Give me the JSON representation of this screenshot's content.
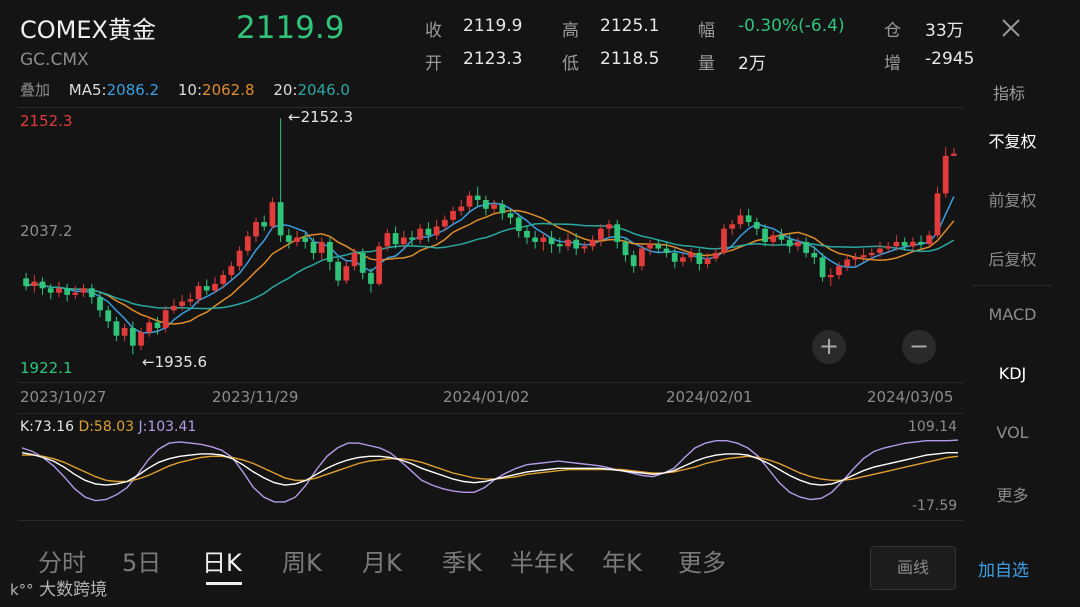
{
  "header": {
    "title": "COMEX黄金",
    "symbol": "GC.CMX",
    "price": "2119.9",
    "quote": {
      "close_label": "收",
      "close": "2119.9",
      "open_label": "开",
      "open": "2123.3",
      "high_label": "高",
      "high": "2125.1",
      "low_label": "低",
      "low": "2118.5",
      "change_label": "幅",
      "change": "-0.30%(-6.4)",
      "volume_label": "量",
      "volume": "2万",
      "position_label": "仓",
      "position": "33万",
      "increase_label": "增",
      "increase": "-2945"
    }
  },
  "ma": {
    "overlay_label": "叠加",
    "ma5_label": "MA5:",
    "ma5": "2086.2",
    "ma10_label": "10:",
    "ma10": "2062.8",
    "ma20_label": "20:",
    "ma20": "2046.0"
  },
  "indicator_label": "指标",
  "sidebar": [
    "不复权",
    "前复权",
    "后复权",
    "MACD",
    "KDJ",
    "VOL",
    "更多"
  ],
  "kline": {
    "max_label": "2152.3",
    "mid_label": "2037.2",
    "min_label": "1922.1",
    "max_marker": "←2152.3",
    "min_marker": "←1935.6",
    "dates": [
      "2023/10/27",
      "2023/11/29",
      "2024/01/02",
      "2024/02/01",
      "2024/03/05"
    ]
  },
  "kdj": {
    "k_label": "K:73.16",
    "d_label": "D:58.03",
    "j_label": "J:103.41",
    "max_label": "109.14",
    "min_label": "-17.59"
  },
  "tabs": [
    "分时",
    "5日",
    "日K",
    "周K",
    "月K",
    "季K",
    "半年K",
    "年K",
    "更多"
  ],
  "draw_button": "画线",
  "watchlist_button": "加自选",
  "watermark": "大数跨境",
  "colors": {
    "up": "#e23b3b",
    "down": "#2fc47a",
    "ma5": "#3a9ee0",
    "ma10": "#e08c2a",
    "ma20": "#2aa8a0",
    "k": "#ffffff",
    "d": "#e0a030",
    "j": "#b49ae6"
  },
  "chart_data": {
    "type": "candlestick",
    "y_range": [
      1922.1,
      2152.3
    ],
    "x_labels": [
      "2023/10/27",
      "2023/11/29",
      "2024/01/02",
      "2024/02/01",
      "2024/03/05"
    ],
    "candles": [
      [
        2007,
        2000,
        2012,
        1996
      ],
      [
        2000,
        2004,
        2010,
        1994
      ],
      [
        2004,
        1998,
        2008,
        1992
      ],
      [
        1998,
        1994,
        2002,
        1988
      ],
      [
        1994,
        1998,
        2004,
        1990
      ],
      [
        1998,
        1992,
        2002,
        1986
      ],
      [
        1992,
        1994,
        2000,
        1988
      ],
      [
        1994,
        1998,
        2002,
        1990
      ],
      [
        1998,
        1990,
        2002,
        1984
      ],
      [
        1990,
        1978,
        1994,
        1972
      ],
      [
        1978,
        1968,
        1982,
        1962
      ],
      [
        1968,
        1955,
        1972,
        1950
      ],
      [
        1955,
        1962,
        1966,
        1950
      ],
      [
        1962,
        1946,
        1968,
        1938
      ],
      [
        1946,
        1958,
        1962,
        1942
      ],
      [
        1958,
        1967,
        1972,
        1954
      ],
      [
        1967,
        1962,
        1972,
        1956
      ],
      [
        1962,
        1978,
        1982,
        1958
      ],
      [
        1978,
        1982,
        1988,
        1975
      ],
      [
        1982,
        1986,
        1992,
        1978
      ],
      [
        1986,
        1988,
        1994,
        1982
      ],
      [
        1988,
        2000,
        2004,
        1984
      ],
      [
        2000,
        1996,
        2006,
        1992
      ],
      [
        1996,
        2002,
        2008,
        1994
      ],
      [
        2002,
        2010,
        2014,
        1998
      ],
      [
        2010,
        2018,
        2022,
        2006
      ],
      [
        2018,
        2032,
        2036,
        2014
      ],
      [
        2032,
        2045,
        2050,
        2028
      ],
      [
        2045,
        2058,
        2062,
        2040
      ],
      [
        2058,
        2054,
        2064,
        2050
      ],
      [
        2054,
        2076,
        2080,
        2052
      ],
      [
        2076,
        2046,
        2152,
        2040
      ],
      [
        2046,
        2040,
        2052,
        2034
      ],
      [
        2040,
        2044,
        2050,
        2036
      ],
      [
        2044,
        2040,
        2048,
        2034
      ],
      [
        2040,
        2030,
        2044,
        2024
      ],
      [
        2030,
        2040,
        2044,
        2024
      ],
      [
        2040,
        2022,
        2044,
        2014
      ],
      [
        2022,
        2005,
        2026,
        2000
      ],
      [
        2005,
        2018,
        2022,
        2002
      ],
      [
        2018,
        2030,
        2034,
        2014
      ],
      [
        2030,
        2012,
        2034,
        2006
      ],
      [
        2012,
        2002,
        2016,
        1994
      ],
      [
        2002,
        2036,
        2040,
        2000
      ],
      [
        2036,
        2048,
        2052,
        2032
      ],
      [
        2048,
        2038,
        2054,
        2034
      ],
      [
        2038,
        2044,
        2050,
        2034
      ],
      [
        2044,
        2042,
        2050,
        2036
      ],
      [
        2042,
        2052,
        2056,
        2038
      ],
      [
        2052,
        2046,
        2058,
        2040
      ],
      [
        2046,
        2054,
        2060,
        2042
      ],
      [
        2054,
        2060,
        2064,
        2050
      ],
      [
        2060,
        2068,
        2072,
        2056
      ],
      [
        2068,
        2072,
        2078,
        2064
      ],
      [
        2072,
        2082,
        2086,
        2068
      ],
      [
        2082,
        2078,
        2090,
        2072
      ],
      [
        2078,
        2070,
        2082,
        2064
      ],
      [
        2070,
        2074,
        2078,
        2066
      ],
      [
        2074,
        2066,
        2078,
        2060
      ],
      [
        2066,
        2062,
        2070,
        2056
      ],
      [
        2062,
        2050,
        2066,
        2044
      ],
      [
        2050,
        2044,
        2054,
        2038
      ],
      [
        2044,
        2040,
        2050,
        2034
      ],
      [
        2040,
        2044,
        2048,
        2032
      ],
      [
        2044,
        2038,
        2050,
        2030
      ],
      [
        2038,
        2036,
        2044,
        2030
      ],
      [
        2036,
        2042,
        2048,
        2032
      ],
      [
        2042,
        2034,
        2048,
        2028
      ],
      [
        2034,
        2036,
        2040,
        2030
      ],
      [
        2036,
        2042,
        2046,
        2032
      ],
      [
        2042,
        2052,
        2056,
        2036
      ],
      [
        2052,
        2056,
        2060,
        2044
      ],
      [
        2056,
        2040,
        2060,
        2034
      ],
      [
        2040,
        2028,
        2044,
        2022
      ],
      [
        2028,
        2018,
        2032,
        2012
      ],
      [
        2018,
        2034,
        2038,
        2014
      ],
      [
        2034,
        2038,
        2042,
        2028
      ],
      [
        2038,
        2034,
        2042,
        2030
      ],
      [
        2034,
        2030,
        2040,
        2026
      ],
      [
        2030,
        2022,
        2034,
        2016
      ],
      [
        2022,
        2026,
        2030,
        2018
      ],
      [
        2026,
        2030,
        2034,
        2022
      ],
      [
        2030,
        2020,
        2034,
        2014
      ],
      [
        2020,
        2025,
        2030,
        2016
      ],
      [
        2025,
        2030,
        2034,
        2022
      ],
      [
        2030,
        2052,
        2056,
        2028
      ],
      [
        2052,
        2056,
        2060,
        2046
      ],
      [
        2056,
        2064,
        2070,
        2052
      ],
      [
        2064,
        2058,
        2070,
        2054
      ],
      [
        2058,
        2052,
        2062,
        2046
      ],
      [
        2052,
        2040,
        2056,
        2036
      ],
      [
        2040,
        2046,
        2050,
        2036
      ],
      [
        2046,
        2042,
        2052,
        2038
      ],
      [
        2042,
        2036,
        2048,
        2030
      ],
      [
        2036,
        2040,
        2044,
        2032
      ],
      [
        2040,
        2030,
        2044,
        2026
      ],
      [
        2030,
        2026,
        2036,
        2020
      ],
      [
        2026,
        2008,
        2030,
        2004
      ],
      [
        2008,
        2010,
        2016,
        2000
      ],
      [
        2010,
        2018,
        2022,
        2006
      ],
      [
        2018,
        2024,
        2028,
        2014
      ],
      [
        2024,
        2026,
        2030,
        2018
      ],
      [
        2026,
        2028,
        2034,
        2022
      ],
      [
        2028,
        2030,
        2034,
        2024
      ],
      [
        2030,
        2034,
        2040,
        2026
      ],
      [
        2034,
        2036,
        2040,
        2030
      ],
      [
        2036,
        2040,
        2046,
        2032
      ],
      [
        2040,
        2036,
        2044,
        2032
      ],
      [
        2036,
        2040,
        2044,
        2032
      ],
      [
        2040,
        2038,
        2046,
        2034
      ],
      [
        2038,
        2046,
        2050,
        2036
      ],
      [
        2046,
        2084,
        2090,
        2044
      ],
      [
        2084,
        2118,
        2126,
        2080
      ],
      [
        2118,
        2120,
        2125,
        2118
      ]
    ],
    "kdj": {
      "k": [
        88,
        85,
        80,
        74,
        64,
        52,
        42,
        36,
        34,
        36,
        40,
        50,
        62,
        72,
        78,
        82,
        84,
        86,
        86,
        84,
        78,
        68,
        56,
        46,
        38,
        34,
        36,
        42,
        52,
        62,
        70,
        76,
        80,
        82,
        82,
        80,
        76,
        70,
        62,
        56,
        50,
        44,
        40,
        38,
        40,
        44,
        48,
        52,
        56,
        58,
        60,
        62,
        62,
        62,
        62,
        62,
        60,
        58,
        56,
        54,
        52,
        54,
        58,
        66,
        74,
        80,
        84,
        86,
        86,
        84,
        78,
        70,
        60,
        50,
        42,
        36,
        34,
        36,
        42,
        50,
        58,
        64,
        68,
        72,
        76,
        80,
        84,
        86,
        88,
        88
      ],
      "d": [
        84,
        84,
        82,
        78,
        72,
        64,
        56,
        48,
        42,
        40,
        40,
        44,
        50,
        58,
        66,
        72,
        76,
        80,
        82,
        82,
        80,
        76,
        70,
        62,
        54,
        46,
        42,
        42,
        46,
        52,
        58,
        64,
        70,
        74,
        76,
        78,
        78,
        76,
        72,
        66,
        60,
        54,
        50,
        46,
        44,
        44,
        46,
        48,
        52,
        54,
        56,
        58,
        60,
        60,
        60,
        60,
        60,
        60,
        58,
        56,
        54,
        54,
        56,
        60,
        64,
        70,
        74,
        78,
        80,
        82,
        80,
        76,
        70,
        62,
        54,
        48,
        44,
        42,
        42,
        44,
        48,
        52,
        56,
        60,
        64,
        68,
        72,
        76,
        80,
        82
      ],
      "j": [
        96,
        90,
        80,
        66,
        48,
        28,
        14,
        8,
        10,
        18,
        30,
        52,
        76,
        94,
        104,
        106,
        104,
        102,
        98,
        92,
        80,
        56,
        30,
        14,
        6,
        6,
        14,
        34,
        60,
        82,
        96,
        104,
        104,
        100,
        96,
        88,
        74,
        58,
        42,
        34,
        28,
        24,
        22,
        22,
        30,
        44,
        54,
        62,
        68,
        70,
        72,
        74,
        72,
        70,
        68,
        66,
        62,
        58,
        54,
        50,
        48,
        54,
        62,
        80,
        96,
        104,
        108,
        108,
        104,
        96,
        82,
        60,
        38,
        22,
        14,
        10,
        12,
        22,
        40,
        60,
        78,
        90,
        96,
        100,
        104,
        106,
        108,
        108,
        108,
        109
      ]
    }
  }
}
